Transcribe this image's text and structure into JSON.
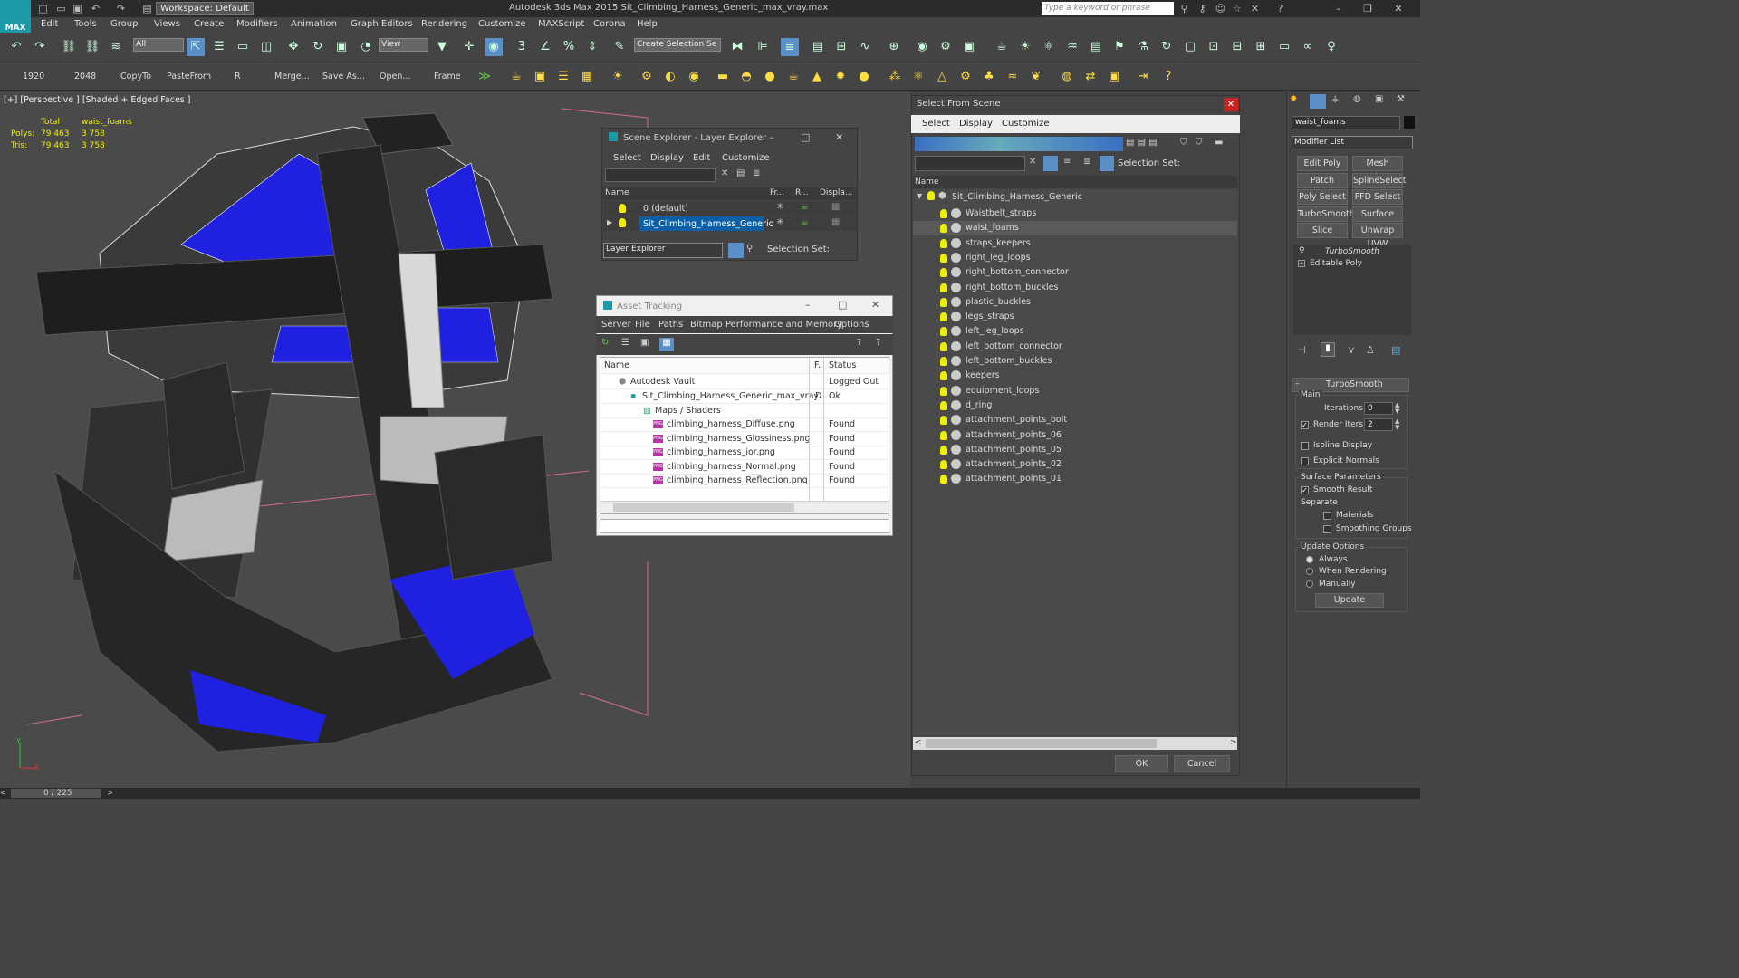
{
  "app": {
    "title": "Autodesk 3ds Max  2015    Sit_Climbing_Harness_Generic_max_vray.max",
    "logo_text": "MAX",
    "workspace": "Workspace: Default",
    "search_placeholder": "Type a keyword or phrase"
  },
  "menu": [
    "Edit",
    "Tools",
    "Group",
    "Views",
    "Create",
    "Modifiers",
    "Animation",
    "Graph Editors",
    "Rendering",
    "Customize",
    "MAXScript",
    "Corona",
    "Help"
  ],
  "toolbar": {
    "selection_filter": "All",
    "ref_coord": "View",
    "named_selection": "Create Selection Se"
  },
  "quickbar": [
    "1920",
    "2048",
    "CopyTo",
    "PasteFrom",
    "R",
    "Merge...",
    "Save As...",
    "Open...",
    "Frame"
  ],
  "viewport": {
    "label": "[+] [Perspective ] [Shaded + Edged Faces ]",
    "stats": {
      "col_total": "Total",
      "col_obj": "waist_foams",
      "polys_label": "Polys:",
      "polys_total": "79 463",
      "polys_obj": "3 758",
      "tris_label": "Tris:",
      "tris_total": "79 463",
      "tris_obj": "3 758"
    },
    "axis_y": "Y",
    "axis_x": "X"
  },
  "layer_explorer": {
    "title": "Scene Explorer - Layer Explorer",
    "menu": [
      "Select",
      "Display",
      "Edit",
      "Customize"
    ],
    "cols": [
      "Name",
      "Fr...",
      "R...",
      "Displa..."
    ],
    "rows": [
      "0 (default)",
      "Sit_Climbing_Harness_Generic"
    ],
    "footer_dropdown": "Layer Explorer",
    "footer_selset": "Selection Set:"
  },
  "asset_tracking": {
    "title": "Asset Tracking",
    "menu": [
      "Server",
      "File",
      "Paths",
      "Bitmap Performance and Memory",
      "Options"
    ],
    "cols": [
      "Name",
      "F.",
      "Status"
    ],
    "rows": [
      {
        "name": "Autodesk Vault",
        "f": "",
        "status": "Logged Out ..."
      },
      {
        "name": "Sit_Climbing_Harness_Generic_max_vray...",
        "f": "D",
        "status": "Ok"
      },
      {
        "name": "Maps / Shaders",
        "f": "",
        "status": ""
      },
      {
        "name": "climbing_harness_Diffuse.png",
        "f": "",
        "status": "Found"
      },
      {
        "name": "climbing_harness_Glossiness.png",
        "f": "",
        "status": "Found"
      },
      {
        "name": "climbing_harness_ior.png",
        "f": "",
        "status": "Found"
      },
      {
        "name": "climbing_harness_Normal.png",
        "f": "",
        "status": "Found"
      },
      {
        "name": "climbing_harness_Reflection.png",
        "f": "",
        "status": "Found"
      }
    ],
    "png_badge": "PNG"
  },
  "select_from_scene": {
    "title": "Select From Scene",
    "menu": [
      "Select",
      "Display",
      "Customize"
    ],
    "selset": "Selection Set:",
    "col_name": "Name",
    "root": "Sit_Climbing_Harness_Generic",
    "items": [
      "Waistbelt_straps",
      "waist_foams",
      "straps_keepers",
      "right_leg_loops",
      "right_bottom_connector",
      "right_bottom_buckles",
      "plastic_buckles",
      "legs_straps",
      "left_leg_loops",
      "left_bottom_connector",
      "left_bottom_buckles",
      "keepers",
      "equipment_loops",
      "d_ring",
      "attachment_points_bolt",
      "attachment_points_06",
      "attachment_points_05",
      "attachment_points_02",
      "attachment_points_01"
    ],
    "ok": "OK",
    "cancel": "Cancel"
  },
  "command_panel": {
    "object_name": "waist_foams",
    "modifier_list": "Modifier List",
    "buttons": [
      "Edit Poly",
      "Mesh Select",
      "Patch Select",
      "SplineSelect",
      "Poly Select",
      "FFD Select",
      "TurboSmooth",
      "Surface Select",
      "Slice",
      "Unwrap UVW"
    ],
    "stack": [
      "TurboSmooth",
      "Editable Poly"
    ],
    "rollout_title": "TurboSmooth",
    "main": "Main",
    "iterations_label": "Iterations:",
    "iterations": "0",
    "render_iters_label": "Render Iters:",
    "render_iters": "2",
    "isoline": "Isoline Display",
    "explicit": "Explicit Normals",
    "surface_params": "Surface Parameters",
    "smooth_result": "Smooth Result",
    "separate": "Separate",
    "materials": "Materials",
    "smoothing_groups": "Smoothing Groups",
    "update_options": "Update Options",
    "always": "Always",
    "when_rendering": "When Rendering",
    "manually": "Manually",
    "update": "Update"
  },
  "status": {
    "frame": "0 / 225"
  },
  "colors": {
    "accent_blue": "#2020e0",
    "selection": "#0b5fa5",
    "viewport_bg": "#4a4a4a"
  }
}
